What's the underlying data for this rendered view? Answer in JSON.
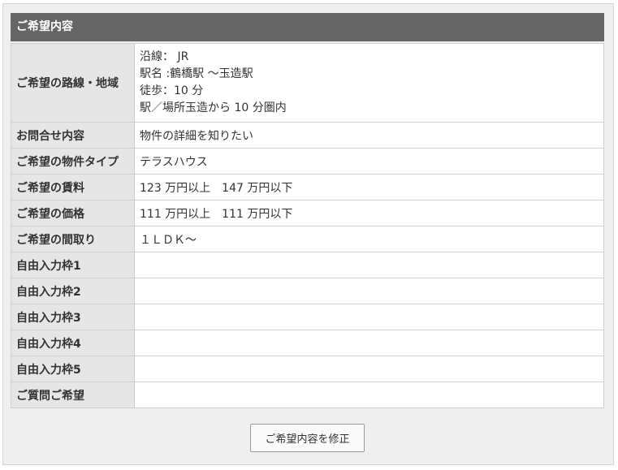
{
  "panel": {
    "title": "ご希望内容"
  },
  "route": {
    "label": "ご希望の路線・地域",
    "line1": "沿線： JR",
    "line2": "駅名 :鶴橋駅 ～玉造駅",
    "line3": "徒歩：10 分",
    "line4": "駅／場所玉造から 10 分圏内"
  },
  "rows": [
    {
      "label": "お問合せ内容",
      "value": "物件の詳細を知りたい"
    },
    {
      "label": "ご希望の物件タイプ",
      "value": "テラスハウス"
    },
    {
      "label": "ご希望の賃料",
      "value": "123 万円以上　147 万円以下"
    },
    {
      "label": "ご希望の価格",
      "value": "111 万円以上　111 万円以下"
    },
    {
      "label": "ご希望の間取り",
      "value": "１ＬＤＫ～"
    },
    {
      "label": "自由入力枠1",
      "value": ""
    },
    {
      "label": "自由入力枠2",
      "value": ""
    },
    {
      "label": "自由入力枠3",
      "value": ""
    },
    {
      "label": "自由入力枠4",
      "value": ""
    },
    {
      "label": "自由入力枠5",
      "value": ""
    },
    {
      "label": "ご質問ご希望",
      "value": ""
    }
  ],
  "actions": {
    "edit_label": "ご希望内容を修正"
  }
}
